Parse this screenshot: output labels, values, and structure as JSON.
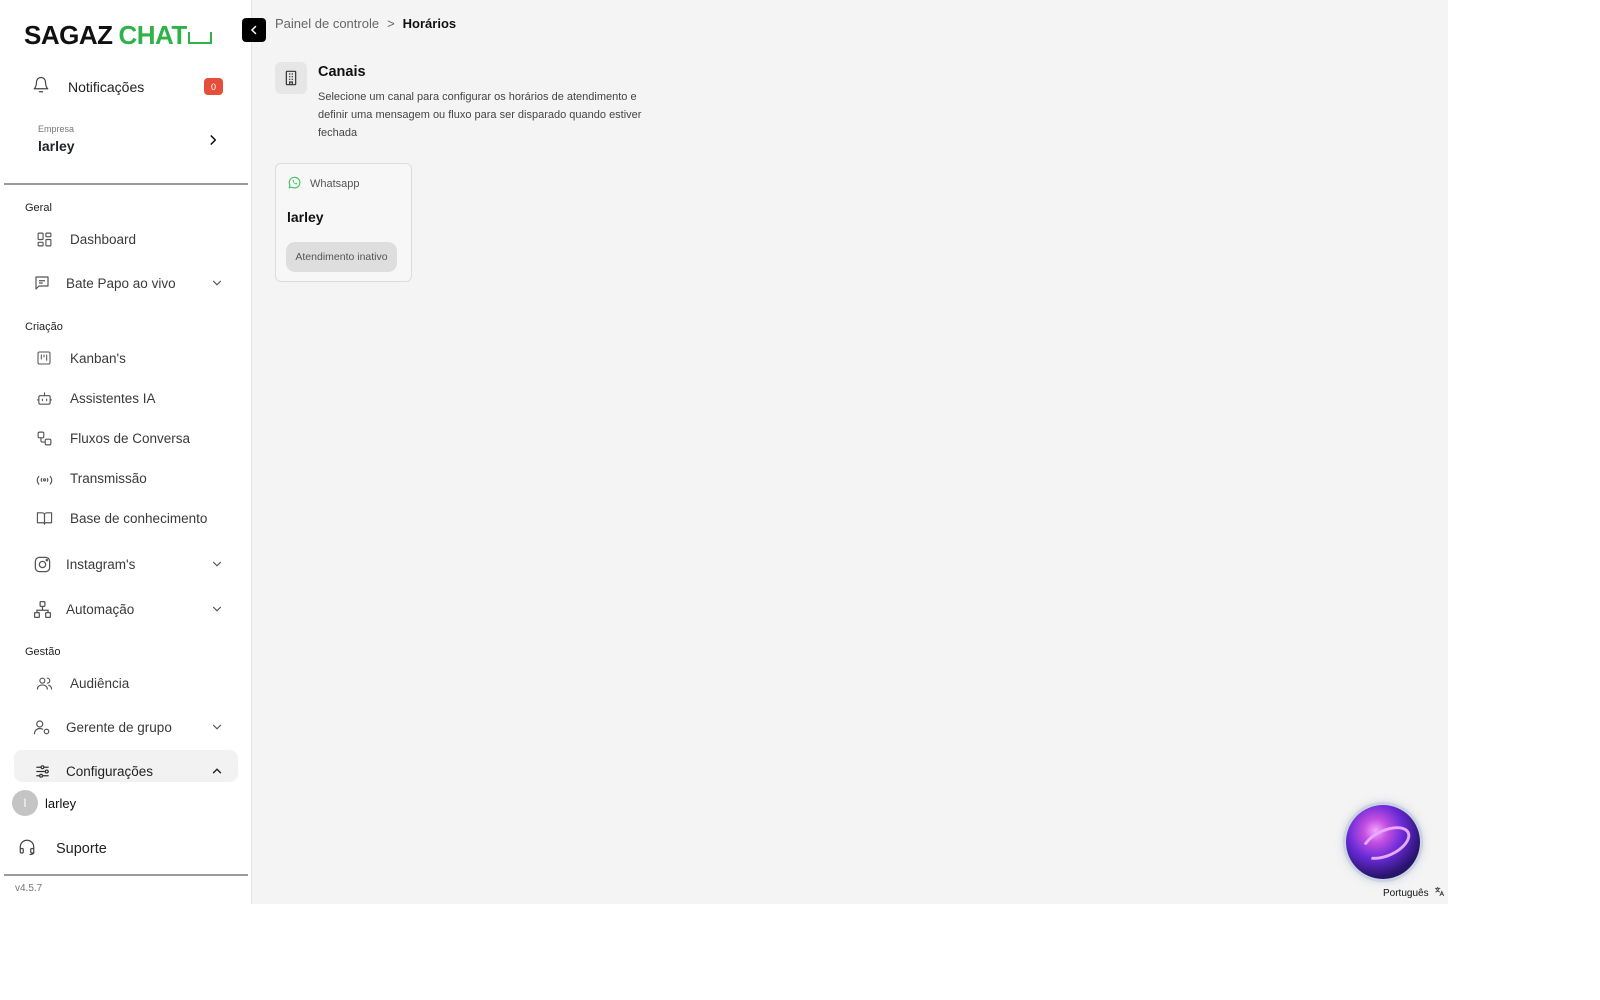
{
  "logo": {
    "part1": "SAGAZ",
    "part2": "CHAT"
  },
  "sidebar": {
    "notifications": {
      "label": "Notificações",
      "count": "0"
    },
    "company": {
      "caption": "Empresa",
      "name": "larley"
    },
    "sections": {
      "geral": "Geral",
      "criacao": "Criação",
      "gestao": "Gestão"
    },
    "items": {
      "dashboard": "Dashboard",
      "bate_papo": "Bate Papo ao vivo",
      "kanbans": "Kanban's",
      "assistentes": "Assistentes IA",
      "fluxos": "Fluxos de Conversa",
      "transmissao": "Transmissão",
      "base": "Base de conhecimento",
      "instagram": "Instagram's",
      "automacao": "Automação",
      "audiencia": "Audiência",
      "gerente_grupo": "Gerente de grupo",
      "configuracoes": "Configurações"
    },
    "user": {
      "initial": "l",
      "name": "larley"
    },
    "support": "Suporte",
    "version": "v4.5.7"
  },
  "breadcrumb": {
    "parent": "Painel de controle",
    "separator": ">",
    "current": "Horários"
  },
  "header": {
    "title": "Canais",
    "description": "Selecione um canal para configurar os horários de atendimento e definir uma mensagem ou fluxo para ser disparado quando estiver fechada"
  },
  "channels": [
    {
      "type": "Whatsapp",
      "name": "larley",
      "status": "Atendimento inativo"
    }
  ],
  "language": "Português",
  "colors": {
    "brand_green": "#2fb24a",
    "badge_red": "#e44e3a",
    "whatsapp_green": "#3fc35a"
  }
}
